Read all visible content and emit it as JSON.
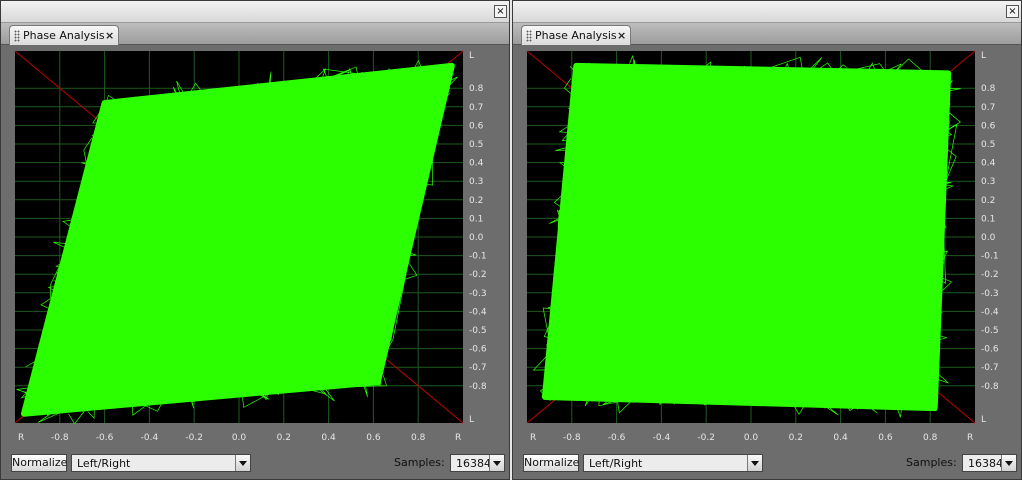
{
  "panels": [
    {
      "tab_label": "Phase Analysis",
      "tab_close": "×",
      "window_close": "×",
      "normalize_label": "Normalize",
      "channel_select": "Left/Right",
      "samples_label": "Samples:",
      "samples_value": "16384",
      "scope": {
        "y_ticks": [
          "L",
          "0.8",
          "0.7",
          "0.6",
          "0.5",
          "0.4",
          "0.3",
          "0.2",
          "0.1",
          "0.0",
          "-0.1",
          "-0.2",
          "-0.3",
          "-0.4",
          "-0.5",
          "-0.6",
          "-0.7",
          "-0.8",
          "L"
        ],
        "x_ticks": [
          "R",
          "-0.8",
          "-0.6",
          "-0.4",
          "-0.2",
          "0.0",
          "0.2",
          "0.4",
          "0.6",
          "0.8",
          "R"
        ],
        "shape": "parallelogram",
        "trace_color": "#2bff00",
        "grid_color": "#1f5a1f",
        "diagonal_color": "#c00000"
      }
    },
    {
      "tab_label": "Phase Analysis",
      "tab_close": "×",
      "window_close": "×",
      "normalize_label": "Normalize",
      "channel_select": "Left/Right",
      "samples_label": "Samples:",
      "samples_value": "16384",
      "scope": {
        "y_ticks": [
          "L",
          "0.8",
          "0.7",
          "0.6",
          "0.5",
          "0.4",
          "0.3",
          "0.2",
          "0.1",
          "0.0",
          "-0.1",
          "-0.2",
          "-0.3",
          "-0.4",
          "-0.5",
          "-0.6",
          "-0.7",
          "-0.8",
          "L"
        ],
        "x_ticks": [
          "R",
          "-0.8",
          "-0.6",
          "-0.4",
          "-0.2",
          "0.0",
          "0.2",
          "0.4",
          "0.6",
          "0.8",
          "R"
        ],
        "shape": "square",
        "trace_color": "#2bff00",
        "grid_color": "#1f5a1f",
        "diagonal_color": "#c00000"
      }
    }
  ]
}
